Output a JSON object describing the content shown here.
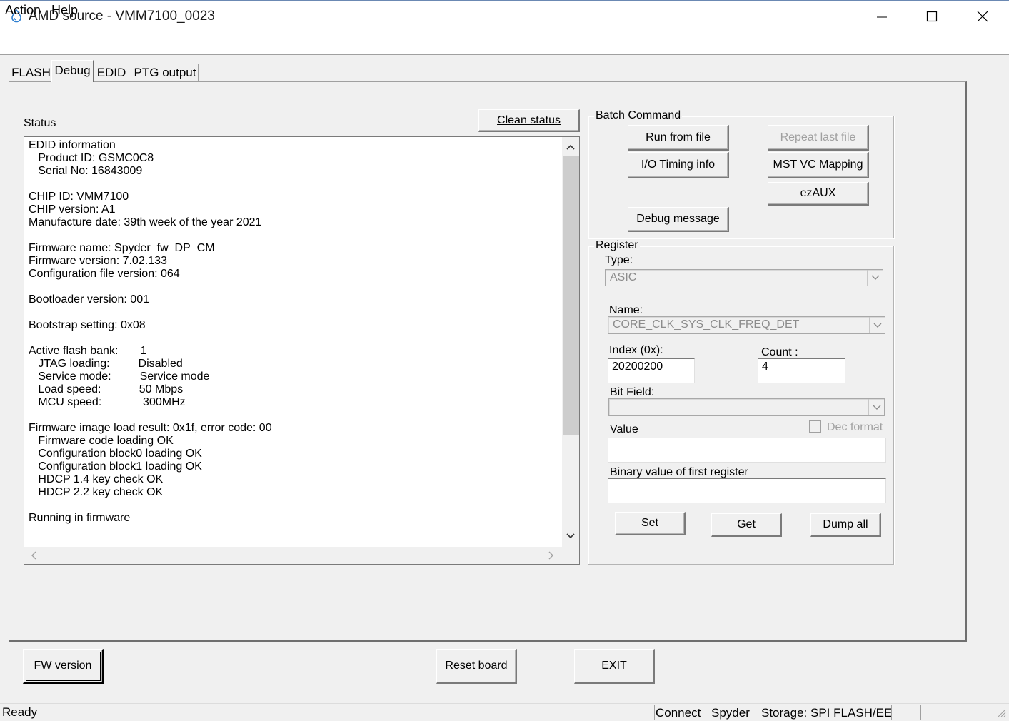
{
  "window": {
    "title": "AMD source - VMM7100_0023"
  },
  "menu": {
    "items": [
      "Action",
      "Help"
    ]
  },
  "tabs": {
    "items": [
      "FLASH",
      "Debug",
      "EDID",
      "PTG output"
    ],
    "active": "Debug"
  },
  "status": {
    "label": "Status",
    "clean_button": "Clean status",
    "text": "EDID information\n   Product ID: GSMC0C8\n   Serial No: 16843009\n\nCHIP ID: VMM7100\nCHIP version: A1\nManufacture date: 39th week of the year 2021\n\nFirmware name: Spyder_fw_DP_CM\nFirmware version: 7.02.133\nConfiguration file version: 064\n\nBootloader version: 001\n\nBootstrap setting: 0x08\n\nActive flash bank:       1\n   JTAG loading:         Disabled\n   Service mode:         Service mode\n   Load speed:            50 Mbps\n   MCU speed:             300MHz\n\nFirmware image load result: 0x1f, error code: 00\n   Firmware code loading OK\n   Configuration block0 loading OK\n   Configuration block1 loading OK\n   HDCP 1.4 key check OK\n   HDCP 2.2 key check OK\n\nRunning in firmware"
  },
  "batch": {
    "title": "Batch Command",
    "run_from_file": "Run from file",
    "repeat_last_file": "Repeat last file",
    "io_timing": "I/O Timing info",
    "mst_vc": "MST VC Mapping",
    "ezaux": "ezAUX",
    "debug_message": "Debug message"
  },
  "register": {
    "title": "Register",
    "type_label": "Type:",
    "type_value": "ASIC",
    "name_label": "Name:",
    "name_value": "CORE_CLK_SYS_CLK_FREQ_DET",
    "index_label": "Index (0x):",
    "index_value": "20200200",
    "count_label": "Count :",
    "count_value": "4",
    "bitfield_label": "Bit Field:",
    "bitfield_value": "",
    "value_label": "Value",
    "value_value": "",
    "dec_format_label": "Dec format",
    "binary_label": "Binary value of first register",
    "binary_value": "",
    "set_button": "Set",
    "get_button": "Get",
    "dump_button": "Dump all"
  },
  "footer": {
    "fw_version": "FW version",
    "reset_board": "Reset board",
    "exit": "EXIT"
  },
  "statusbar": {
    "ready": "Ready",
    "connect": "Connect",
    "device": "Spyder",
    "storage": "Storage: SPI FLASH/EE"
  },
  "colors": {
    "window_bg": "#f0f0f0",
    "disabled_text": "#a0a0a0",
    "title_border": "#6b89b3"
  },
  "icons": {
    "app": "water-drop-icon",
    "minimize": "minimize-icon",
    "maximize": "maximize-icon",
    "close": "close-icon"
  }
}
